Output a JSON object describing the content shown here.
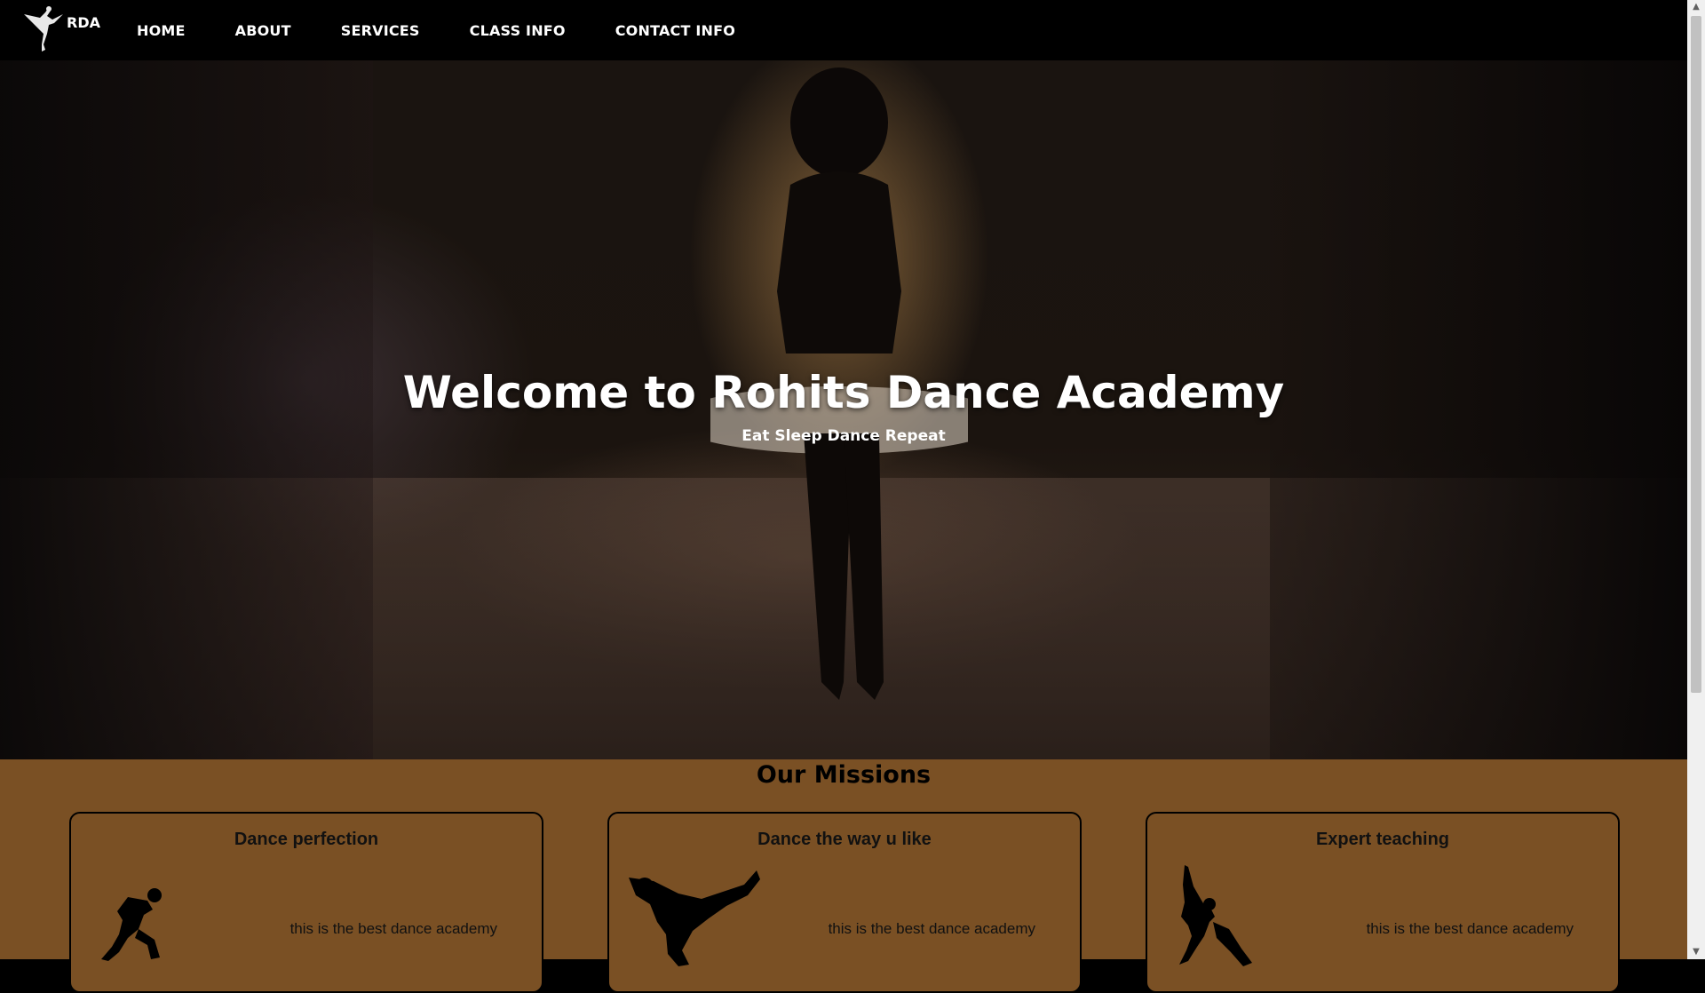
{
  "navbar": {
    "logo_text": "RDA",
    "logo_icon": "ballerina-icon",
    "links": [
      "HOME",
      "ABOUT",
      "SERVICES",
      "CLASS INFO",
      "CONTACT INFO"
    ]
  },
  "hero": {
    "title": "Welcome to Rohits Dance Academy",
    "subtitle": "Eat Sleep Dance Repeat"
  },
  "missions": {
    "title": "Our Missions",
    "cards": [
      {
        "title": "Dance perfection",
        "text": "this is the best dance academy",
        "icon": "breakdancer-icon"
      },
      {
        "title": "Dance the way u like",
        "text": "this is the best dance academy",
        "icon": "freeze-dancer-icon"
      },
      {
        "title": "Expert teaching",
        "text": "this is the best dance academy",
        "icon": "dancer-pose-icon"
      }
    ]
  },
  "colors": {
    "navbar_bg": "#000000",
    "missions_bg": "#7a5024",
    "text_light": "#ffffff",
    "text_dark": "#111111"
  }
}
